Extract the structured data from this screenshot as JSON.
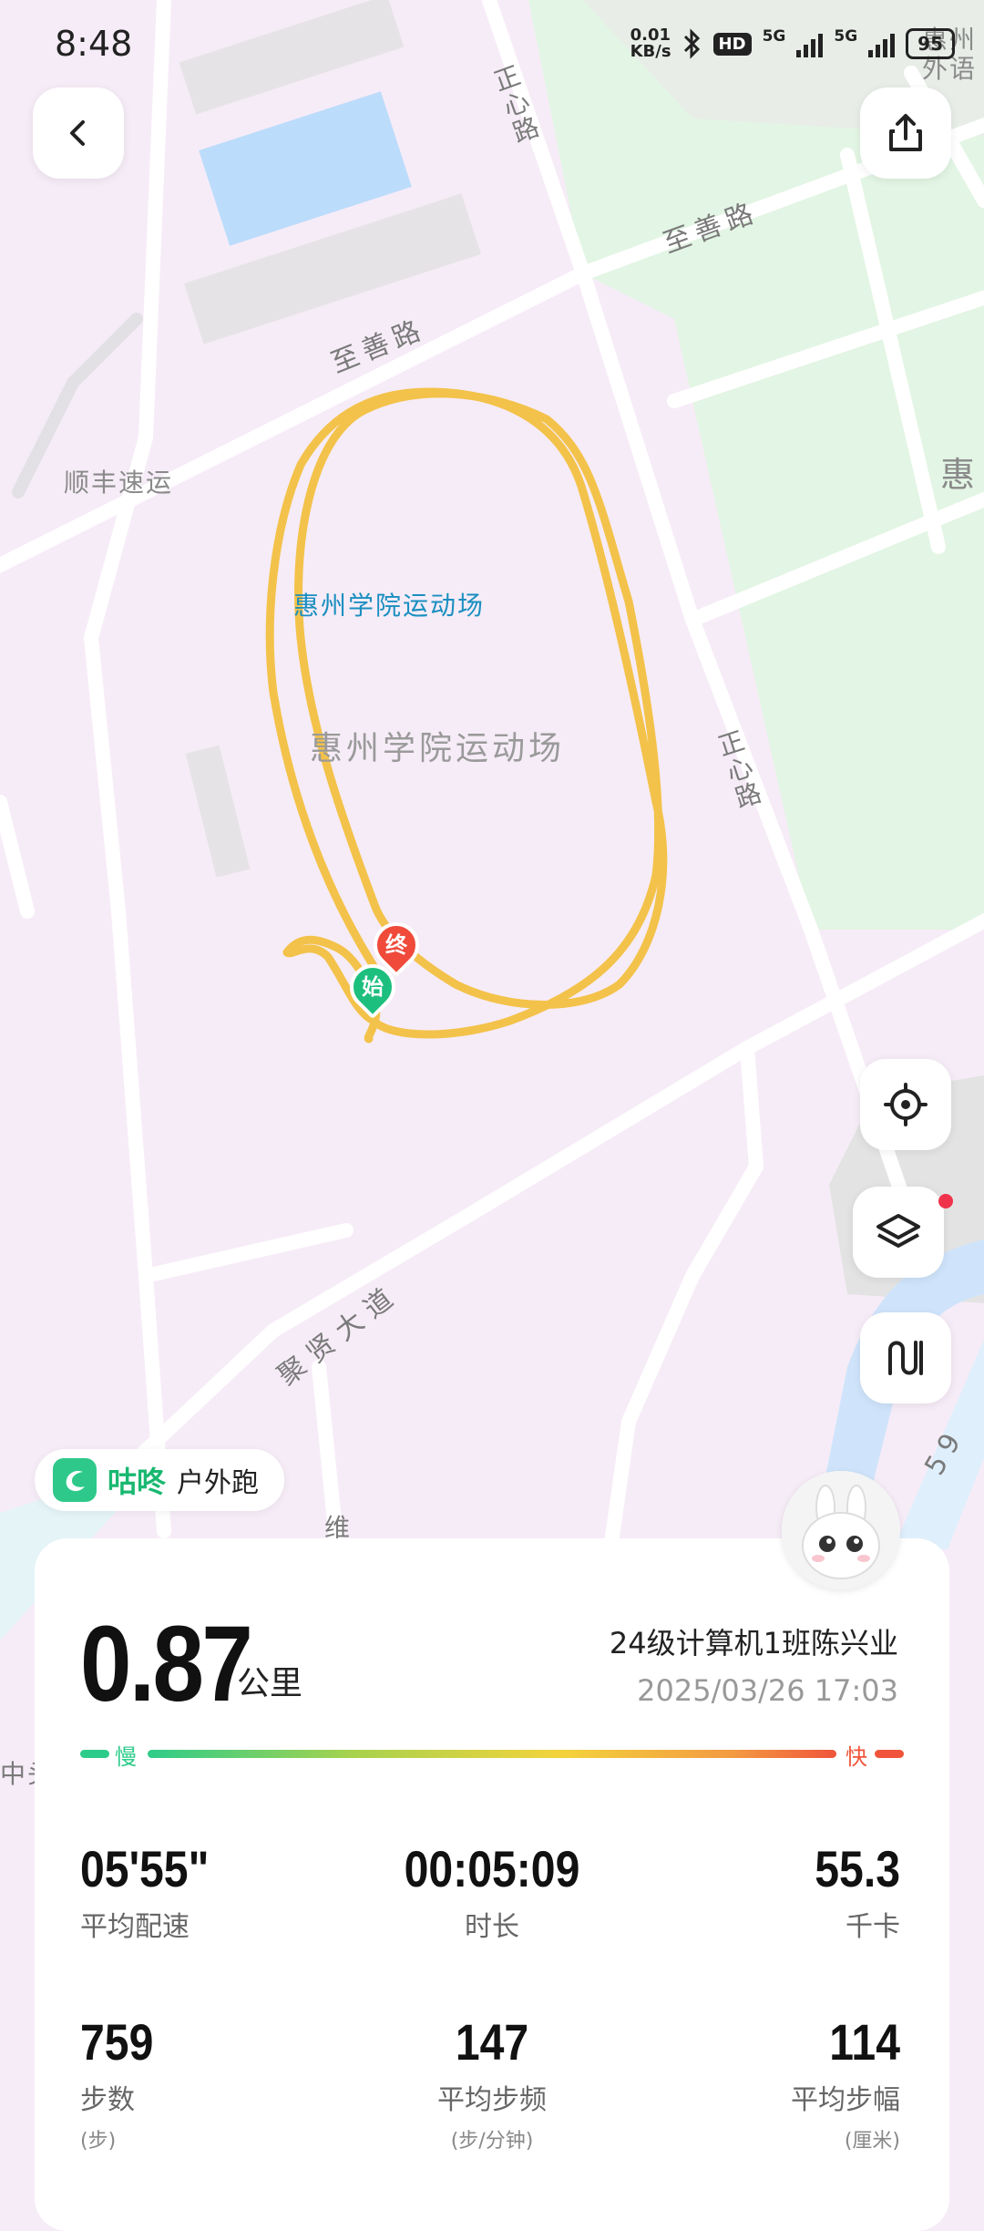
{
  "status": {
    "time": "8:48",
    "net_speed_value": "0.01",
    "net_speed_unit": "KB/s",
    "hd_badge": "HD",
    "sim1": "5G",
    "sim2": "5G",
    "battery": "95"
  },
  "map": {
    "labels": {
      "road_top": "正心路",
      "road_right": "正心路",
      "road_zhishan_left": "至善路",
      "road_zhishan_right": "至善路",
      "shunfeng": "顺丰速运",
      "poi_blue": "惠州学院运动场",
      "area_gray": "惠州学院运动场",
      "avenue": "聚贤大道",
      "wei": "维",
      "hui_right": "惠",
      "foreign": "惠州外语",
      "zhong": "中头",
      "road_59": "59"
    },
    "markers": {
      "start": "始",
      "end": "终"
    },
    "route_color": "#f3c24a"
  },
  "app": {
    "name": "咕咚",
    "type": "户外跑"
  },
  "summary": {
    "distance": "0.87",
    "distance_unit": "公里",
    "user": "24级计算机1班陈兴业",
    "datetime": "2025/03/26 17:03",
    "slow_label": "慢",
    "fast_label": "快"
  },
  "stats": [
    {
      "value": "05'55\"",
      "label": "平均配速"
    },
    {
      "value": "00:05:09",
      "label": "时长"
    },
    {
      "value": "55.3",
      "label": "千卡"
    },
    {
      "value": "759",
      "label": "步数",
      "sub": "(步)"
    },
    {
      "value": "147",
      "label": "平均步频",
      "sub": "(步/分钟)"
    },
    {
      "value": "114",
      "label": "平均步幅",
      "sub": "(厘米)"
    }
  ],
  "colors": {
    "accent": "#19b871",
    "slow": "#2ecc8a",
    "fast": "#f0553b"
  }
}
